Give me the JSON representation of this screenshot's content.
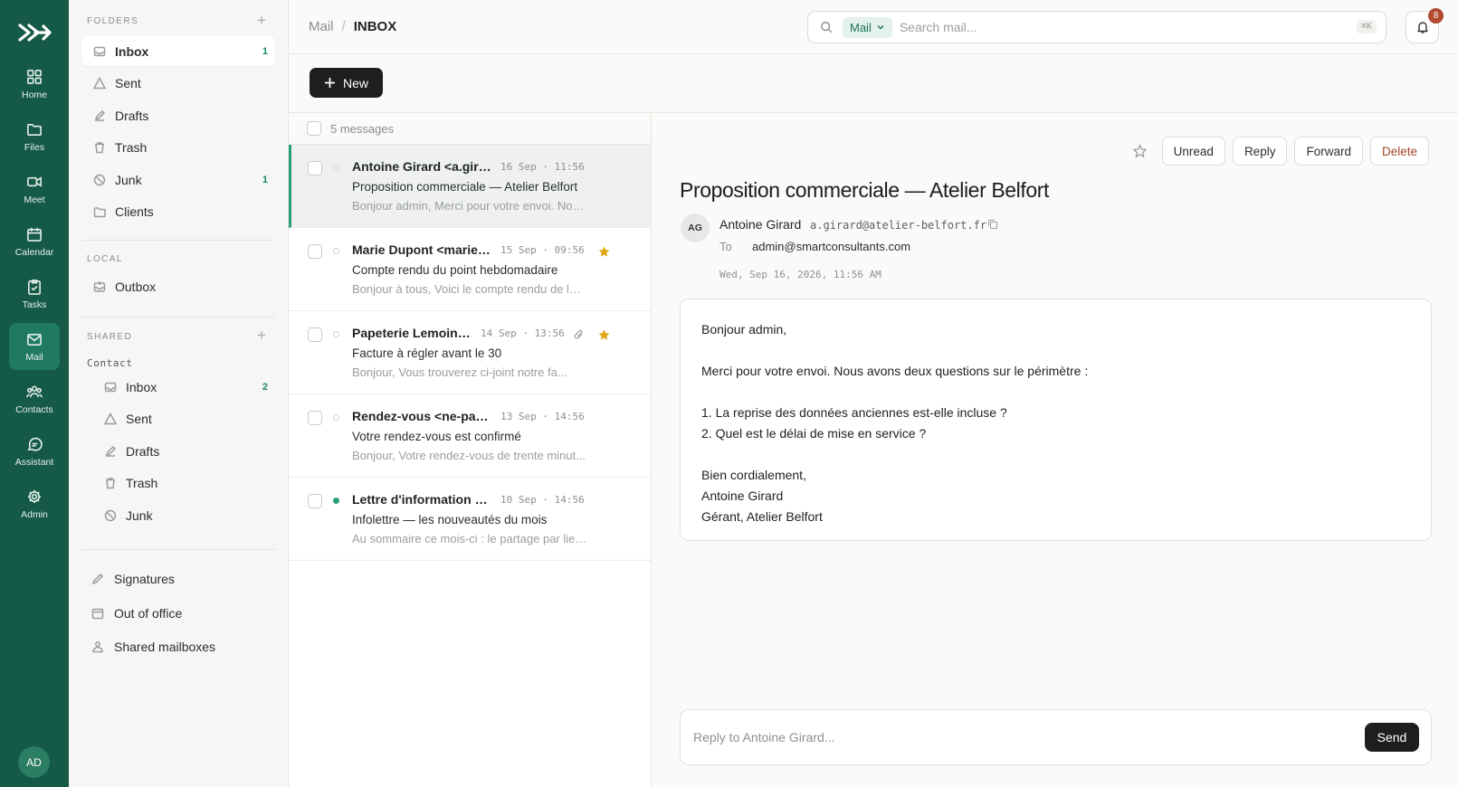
{
  "rail": {
    "items": [
      {
        "label": "Home",
        "icon": "grid-icon"
      },
      {
        "label": "Files",
        "icon": "folder-icon"
      },
      {
        "label": "Meet",
        "icon": "video-icon"
      },
      {
        "label": "Calendar",
        "icon": "calendar-icon"
      },
      {
        "label": "Tasks",
        "icon": "clipboard-icon"
      },
      {
        "label": "Mail",
        "icon": "mail-icon"
      },
      {
        "label": "Contacts",
        "icon": "people-icon"
      },
      {
        "label": "Assistant",
        "icon": "chat-icon"
      },
      {
        "label": "Admin",
        "icon": "gear-icon"
      }
    ],
    "active": "Mail",
    "user_initials": "AD"
  },
  "folders": {
    "heading": "FOLDERS",
    "items": [
      {
        "label": "Inbox",
        "count": "1"
      },
      {
        "label": "Sent",
        "count": ""
      },
      {
        "label": "Drafts",
        "count": ""
      },
      {
        "label": "Trash",
        "count": ""
      },
      {
        "label": "Junk",
        "count": "1"
      },
      {
        "label": "Clients",
        "count": ""
      }
    ],
    "local_heading": "LOCAL",
    "local_items": [
      {
        "label": "Outbox"
      }
    ],
    "shared_heading": "SHARED",
    "shared_owner": "Contact",
    "shared_items": [
      {
        "label": "Inbox",
        "count": "2"
      },
      {
        "label": "Sent",
        "count": ""
      },
      {
        "label": "Drafts",
        "count": ""
      },
      {
        "label": "Trash",
        "count": ""
      },
      {
        "label": "Junk",
        "count": ""
      }
    ],
    "bottom": [
      {
        "label": "Signatures"
      },
      {
        "label": "Out of office"
      },
      {
        "label": "Shared mailboxes"
      }
    ]
  },
  "header": {
    "crumb_root": "Mail",
    "crumb_sep": "/",
    "crumb_current": "INBOX",
    "search": {
      "scope": "Mail",
      "placeholder": "Search mail...",
      "shortcut": "⌘K"
    },
    "notifications": "8"
  },
  "toolbar": {
    "new_label": "New"
  },
  "list": {
    "count_label": "5 messages",
    "messages": [
      {
        "from": "Antoine Girard <a.girar...",
        "date": "16 Sep · 11:56",
        "subject": "Proposition commerciale — Atelier Belfort",
        "preview": "Bonjour admin, Merci pour votre envoi. Nou...",
        "starred": false,
        "attachment": false,
        "unread": false
      },
      {
        "from": "Marie Dupont <marie.d...",
        "date": "15 Sep · 09:56",
        "subject": "Compte rendu du point hebdomadaire",
        "preview": "Bonjour à tous, Voici le compte rendu de la r...",
        "starred": true,
        "attachment": false,
        "unread": false
      },
      {
        "from": "Papeterie Lemoine ...",
        "date": "14 Sep · 13:56",
        "subject": "Facture à régler avant le 30",
        "preview": "Bonjour, Vous trouverez ci-joint notre fa...",
        "starred": true,
        "attachment": true,
        "unread": false
      },
      {
        "from": "Rendez-vous <ne-pas-r...",
        "date": "13 Sep · 14:56",
        "subject": "Votre rendez-vous est confirmé",
        "preview": "Bonjour, Votre rendez-vous de trente minut...",
        "starred": false,
        "attachment": false,
        "unread": false
      },
      {
        "from": "Lettre d'information <n...",
        "date": "10 Sep · 14:56",
        "subject": "Infolettre — les nouveautés du mois",
        "preview": "Au sommaire ce mois-ci : le partage par lien...",
        "starred": false,
        "attachment": false,
        "unread": true
      }
    ]
  },
  "reader": {
    "actions": {
      "unread": "Unread",
      "reply": "Reply",
      "forward": "Forward",
      "delete": "Delete"
    },
    "title": "Proposition commerciale — Atelier Belfort",
    "avatar": "AG",
    "sender_name": "Antoine Girard",
    "sender_email": "a.girard@atelier-belfort.fr",
    "to_label": "To",
    "to": "admin@smartconsultants.com",
    "date": "Wed, Sep 16, 2026, 11:56 AM",
    "body": [
      "Bonjour admin,",
      "",
      "Merci pour votre envoi. Nous avons deux questions sur le périmètre :",
      "",
      "1. La reprise des données anciennes est-elle incluse ?",
      "2. Quel est le délai de mise en service ?",
      "",
      "Bien cordialement,",
      "Antoine Girard",
      "Gérant, Atelier Belfort"
    ],
    "reply_placeholder": "Reply to Antoine Girard...",
    "send_label": "Send"
  },
  "colors": {
    "rail": "#145a47",
    "accent": "#2a9d7c",
    "star": "#e2a614",
    "danger": "#a3442a"
  }
}
